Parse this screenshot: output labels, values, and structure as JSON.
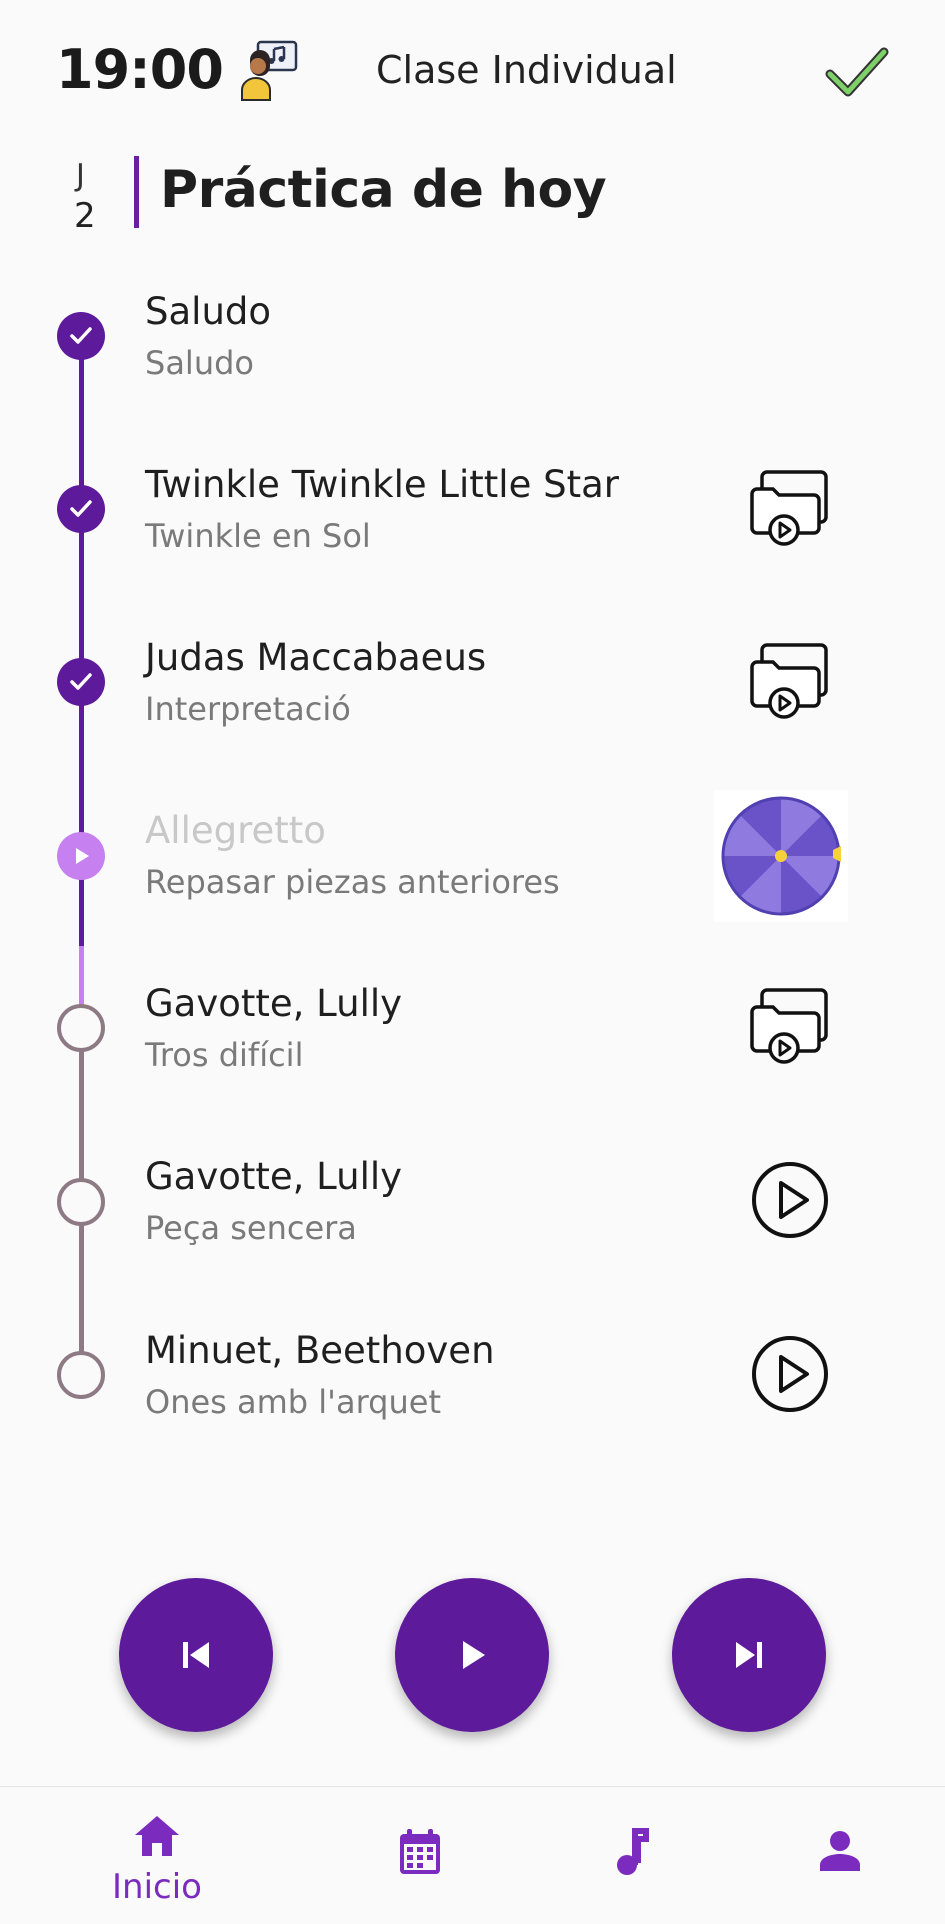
{
  "header": {
    "time": "19:00",
    "teacher_icon": "teacher-music-icon",
    "class_type": "Clase Individual",
    "status_icon": "check-icon"
  },
  "practice": {
    "day_letter": "J",
    "day_number": "2",
    "title": "Práctica de hoy"
  },
  "items": [
    {
      "title": "Saludo",
      "subtitle": "Saludo",
      "state": "done",
      "action": "none"
    },
    {
      "title": "Twinkle Twinkle Little Star",
      "subtitle": "Twinkle en Sol",
      "state": "done",
      "action": "video-folder-icon"
    },
    {
      "title": "Judas Maccabaeus",
      "subtitle": "Interpretació",
      "state": "done",
      "action": "video-folder-icon"
    },
    {
      "title": "Allegretto",
      "subtitle": "Repasar piezas anteriores",
      "state": "current",
      "action": "spin-wheel-icon"
    },
    {
      "title": "Gavotte, Lully",
      "subtitle": "Tros difícil",
      "state": "pending",
      "action": "video-folder-icon"
    },
    {
      "title": "Gavotte, Lully",
      "subtitle": "Peça sencera",
      "state": "pending",
      "action": "play-circle-icon"
    },
    {
      "title": "Minuet, Beethoven",
      "subtitle": "Ones amb l'arquet",
      "state": "pending",
      "action": "play-circle-icon"
    }
  ],
  "controls": {
    "previous_icon": "skip-previous-icon",
    "play_icon": "play-icon",
    "next_icon": "skip-next-icon"
  },
  "nav": {
    "items": [
      {
        "label": "Inicio",
        "icon": "home-icon",
        "active": true
      },
      {
        "label": "",
        "icon": "calendar-icon",
        "active": false
      },
      {
        "label": "",
        "icon": "music-note-icon",
        "active": false
      },
      {
        "label": "",
        "icon": "profile-icon",
        "active": false
      }
    ]
  },
  "colors": {
    "accent": "#5d1a9a",
    "accent_light": "#c680f0",
    "nav_active": "#7b2cbf",
    "pending": "#8e7a84",
    "check_green": "#5cb85c"
  }
}
